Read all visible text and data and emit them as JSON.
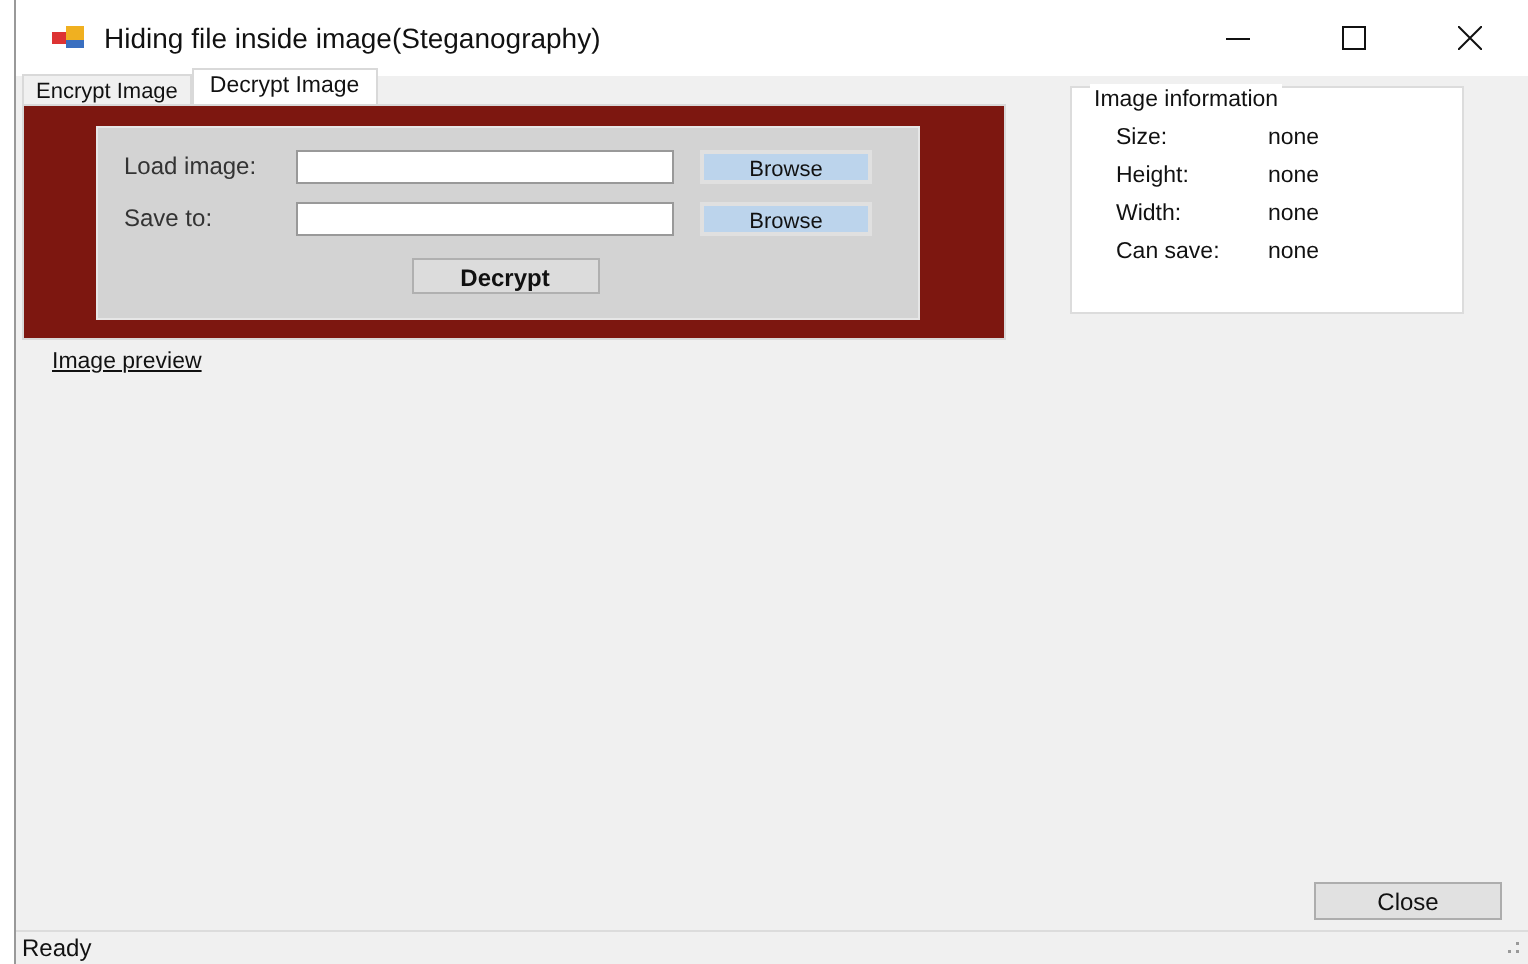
{
  "window": {
    "title": "Hiding file inside image(Steganography)"
  },
  "tabs": [
    {
      "label": "Encrypt Image",
      "selected": false
    },
    {
      "label": "Decrypt Image",
      "selected": true
    }
  ],
  "fields": [
    {
      "label": "Load image:",
      "button": "Browse"
    },
    {
      "label": "Save to:",
      "button": "Browse"
    }
  ],
  "action_button": "Decrypt",
  "preview_link": "Image preview",
  "image_information": {
    "title": "Image information",
    "rows": [
      {
        "label": "Size:",
        "value": "none"
      },
      {
        "label": "Height:",
        "value": "none"
      },
      {
        "label": "Width:",
        "value": "none"
      },
      {
        "label": "Can save:",
        "value": "none"
      }
    ]
  },
  "close_button": "Close",
  "status_bar": "Ready"
}
